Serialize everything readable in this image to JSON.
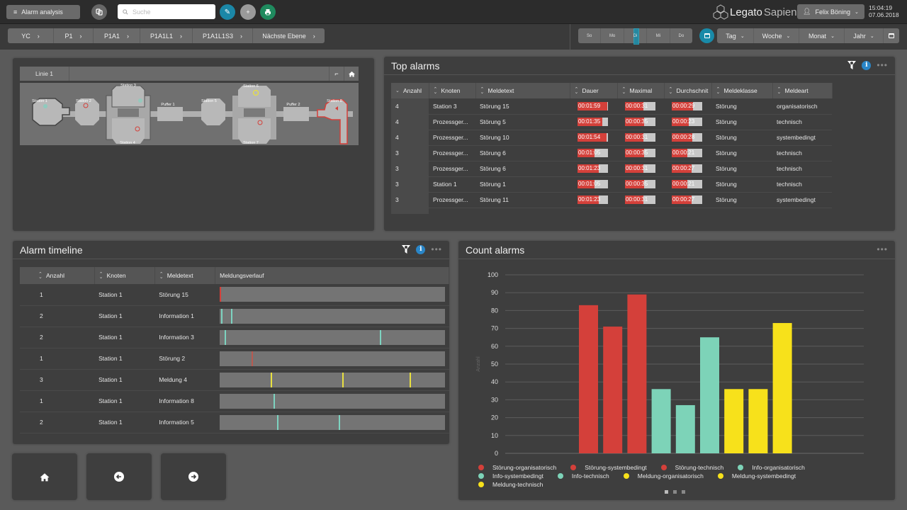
{
  "topbar": {
    "menu_label": "Alarm analysis",
    "search_placeholder": "Suche",
    "logo_part1": "Legato",
    "logo_part2": "Sapient",
    "user_name": "Felix Böning",
    "time": "15:04:19",
    "date": "07.06.2018",
    "colors": {
      "edit": "#1b87a7",
      "add": "#9a9a9a",
      "print": "#1f8a5e"
    }
  },
  "breadcrumbs": [
    "YC",
    "P1",
    "P1A1",
    "P1A1L1",
    "P1A1L1S3",
    "Nächste Ebene"
  ],
  "days": [
    {
      "label": "So",
      "active": false
    },
    {
      "label": "Mo",
      "active": false
    },
    {
      "label": "Di",
      "active": true
    },
    {
      "label": "Mi",
      "active": false
    },
    {
      "label": "Do",
      "active": false
    }
  ],
  "periods": [
    "Tag",
    "Woche",
    "Monat",
    "Jahr"
  ],
  "line_panel": {
    "tab": "Linie 1",
    "stations": [
      "Station 1",
      "Station 2",
      "Station 3",
      "Puffer 1",
      "Station 5",
      "Station 6",
      "Puffer 2",
      "Station 8",
      "Station 4",
      "Station 7"
    ]
  },
  "top_alarms": {
    "title": "Top alarms",
    "columns": [
      "Anzahl",
      "Knoten",
      "Meldetext",
      "Dauer",
      "Maximal",
      "Durchschnit",
      "Meldeklasse",
      "Meldeart"
    ],
    "rows": [
      {
        "anzahl": "4",
        "knoten": "Station 3",
        "meldetext": "Störung 15",
        "dauer": "00:01:59",
        "dauer_pct": 98,
        "maximal": "00:00:31",
        "maximal_pct": 60,
        "durch": "00:00:29",
        "durch_pct": 70,
        "klasse": "Störung",
        "art": "organisatorisch"
      },
      {
        "anzahl": "4",
        "knoten": "Prozessger...",
        "meldetext": "Störung 5",
        "dauer": "00:01:35",
        "dauer_pct": 82,
        "maximal": "00:00:35",
        "maximal_pct": 62,
        "durch": "00:00:23",
        "durch_pct": 55,
        "klasse": "Störung",
        "art": "technisch"
      },
      {
        "anzahl": "4",
        "knoten": "Prozessger...",
        "meldetext": "Störung 10",
        "dauer": "00:01:54",
        "dauer_pct": 96,
        "maximal": "00:00:31",
        "maximal_pct": 60,
        "durch": "00:00:28",
        "durch_pct": 67,
        "klasse": "Störung",
        "art": "systembedingt"
      },
      {
        "anzahl": "3",
        "knoten": "Prozessger...",
        "meldetext": "Störung 6",
        "dauer": "00:01:05",
        "dauer_pct": 55,
        "maximal": "00:00:35",
        "maximal_pct": 62,
        "durch": "00:00:21",
        "durch_pct": 52,
        "klasse": "Störung",
        "art": "technisch"
      },
      {
        "anzahl": "3",
        "knoten": "Prozessger...",
        "meldetext": "Störung 6",
        "dauer": "00:01:23",
        "dauer_pct": 70,
        "maximal": "00:00:31",
        "maximal_pct": 60,
        "durch": "00:00:27",
        "durch_pct": 65,
        "klasse": "Störung",
        "art": "technisch"
      },
      {
        "anzahl": "3",
        "knoten": "Station 1",
        "meldetext": "Störung 1",
        "dauer": "00:01:05",
        "dauer_pct": 55,
        "maximal": "00:00:35",
        "maximal_pct": 62,
        "durch": "00:00:21",
        "durch_pct": 52,
        "klasse": "Störung",
        "art": "technisch"
      },
      {
        "anzahl": "3",
        "knoten": "Prozessger...",
        "meldetext": "Störung 11",
        "dauer": "00:01:23",
        "dauer_pct": 70,
        "maximal": "00:00:31",
        "maximal_pct": 60,
        "durch": "00:00:27",
        "durch_pct": 65,
        "klasse": "Störung",
        "art": "systembedingt"
      }
    ]
  },
  "timeline": {
    "title": "Alarm timeline",
    "columns": [
      "Anzahl",
      "Knoten",
      "Meldetext",
      "Meldungsverlauf"
    ],
    "rows": [
      {
        "anzahl": "1",
        "knoten": "Station 1",
        "meldetext": "Störung 15",
        "color": "#d4403a",
        "marks": [
          0.2
        ]
      },
      {
        "anzahl": "2",
        "knoten": "Station 1",
        "meldetext": "Information 1",
        "color": "#7dd3c0",
        "marks": [
          0.8,
          5.2
        ]
      },
      {
        "anzahl": "2",
        "knoten": "Station 1",
        "meldetext": "Information 3",
        "color": "#7dd3c0",
        "marks": [
          2.3,
          71.1
        ]
      },
      {
        "anzahl": "1",
        "knoten": "Station 1",
        "meldetext": "Störung 2",
        "color": "#b85a50",
        "marks": [
          14.3
        ]
      },
      {
        "anzahl": "3",
        "knoten": "Station 1",
        "meldetext": "Meldung 4",
        "color": "#e8e040",
        "marks": [
          22.9,
          54.5,
          84.3
        ]
      },
      {
        "anzahl": "1",
        "knoten": "Station 1",
        "meldetext": "Information 8",
        "color": "#7dd3c0",
        "marks": [
          23.9
        ]
      },
      {
        "anzahl": "2",
        "knoten": "Station 1",
        "meldetext": "Information 5",
        "color": "#7dd3c0",
        "marks": [
          25.6,
          53.0
        ]
      }
    ]
  },
  "count_alarms": {
    "title": "Count alarms"
  },
  "chart_data": {
    "type": "bar",
    "title": "Count alarms",
    "xlabel": "",
    "ylabel": "Anzahl",
    "ylim": [
      0,
      100
    ],
    "yticks": [
      0,
      10,
      20,
      30,
      40,
      50,
      60,
      70,
      80,
      90,
      100
    ],
    "grid": true,
    "legend_position": "bottom",
    "categories": [
      "Störung-organisatorisch",
      "Störung-systembedingt",
      "Störung-technisch",
      "Info-organisatorisch",
      "Info-systembedingt",
      "Info-technisch",
      "Meldung-organisatorisch",
      "Meldung-systembedingt",
      "Meldung-technisch"
    ],
    "values": [
      83,
      71,
      89,
      36,
      27,
      65,
      36,
      36,
      73
    ],
    "colors": [
      "#d4403a",
      "#d4403a",
      "#d4403a",
      "#7dd3b8",
      "#7dd3b8",
      "#7dd3b8",
      "#f7e11b",
      "#f7e11b",
      "#f7e11b"
    ]
  },
  "nav_tiles": [
    "home-icon",
    "arrow-left-icon",
    "arrow-right-icon"
  ]
}
